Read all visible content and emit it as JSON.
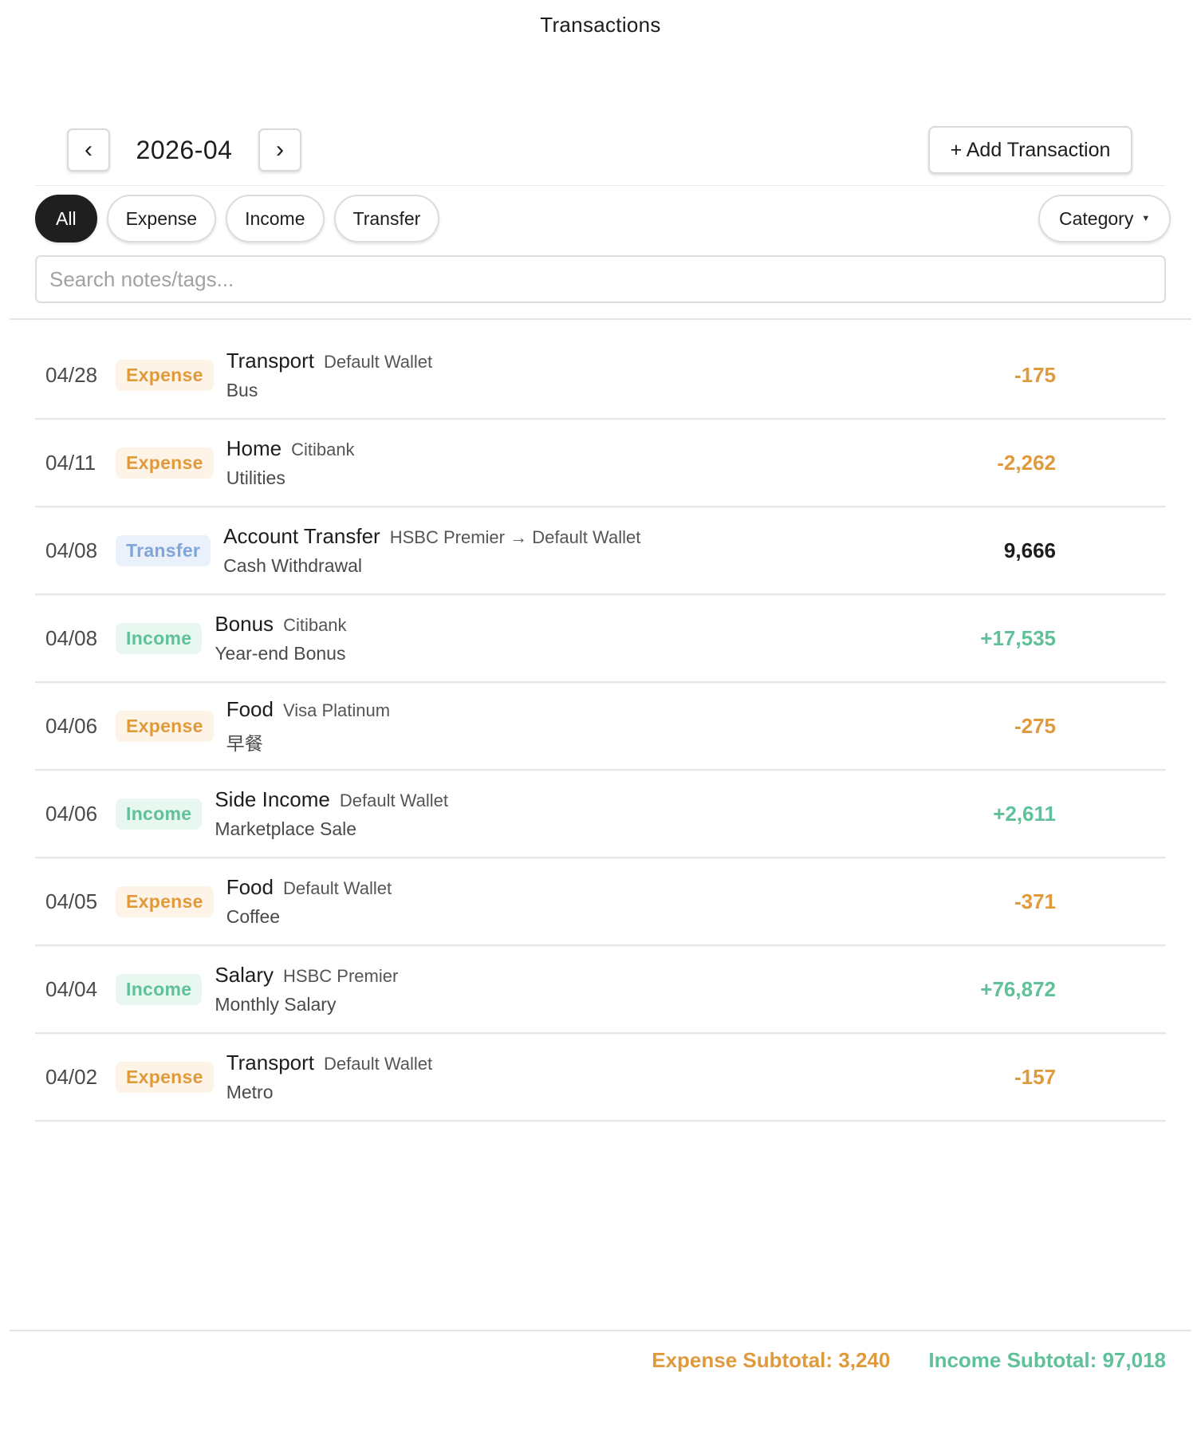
{
  "header": {
    "title": "Transactions"
  },
  "month_nav": {
    "prev_icon": "‹",
    "month": "2026-04",
    "next_icon": "›"
  },
  "add_button": {
    "label": "+ Add Transaction"
  },
  "filters": {
    "tabs": [
      {
        "label": "All",
        "active": true
      },
      {
        "label": "Expense",
        "active": false
      },
      {
        "label": "Income",
        "active": false
      },
      {
        "label": "Transfer",
        "active": false
      }
    ],
    "category": {
      "label": "Category",
      "caret": "▼"
    }
  },
  "search": {
    "placeholder": "Search notes/tags...",
    "value": ""
  },
  "transactions": [
    {
      "date": "04/28",
      "type": "Expense",
      "category": "Transport",
      "account": "Default Wallet",
      "note": "Bus",
      "amount": "-175"
    },
    {
      "date": "04/11",
      "type": "Expense",
      "category": "Home",
      "account": "Citibank",
      "note": "Utilities",
      "amount": "-2,262"
    },
    {
      "date": "04/08",
      "type": "Transfer",
      "category": "Account Transfer",
      "account": "HSBC Premier → Default Wallet",
      "note": "Cash Withdrawal",
      "amount": "9,666"
    },
    {
      "date": "04/08",
      "type": "Income",
      "category": "Bonus",
      "account": "Citibank",
      "note": "Year-end Bonus",
      "amount": "+17,535"
    },
    {
      "date": "04/06",
      "type": "Expense",
      "category": "Food",
      "account": "Visa Platinum",
      "note": "早餐",
      "amount": "-275"
    },
    {
      "date": "04/06",
      "type": "Income",
      "category": "Side Income",
      "account": "Default Wallet",
      "note": "Marketplace Sale",
      "amount": "+2,611"
    },
    {
      "date": "04/05",
      "type": "Expense",
      "category": "Food",
      "account": "Default Wallet",
      "note": "Coffee",
      "amount": "-371"
    },
    {
      "date": "04/04",
      "type": "Income",
      "category": "Salary",
      "account": "HSBC Premier",
      "note": "Monthly Salary",
      "amount": "+76,872"
    },
    {
      "date": "04/02",
      "type": "Expense",
      "category": "Transport",
      "account": "Default Wallet",
      "note": "Metro",
      "amount": "-157"
    }
  ],
  "footer": {
    "expense_subtotal": "Expense Subtotal: 3,240",
    "income_subtotal": "Income Subtotal: 97,018"
  },
  "colors": {
    "expense": "#e09a3c",
    "income": "#5fc099",
    "transfer": "#7fa5d9",
    "active_pill": "#1f1f1f"
  }
}
